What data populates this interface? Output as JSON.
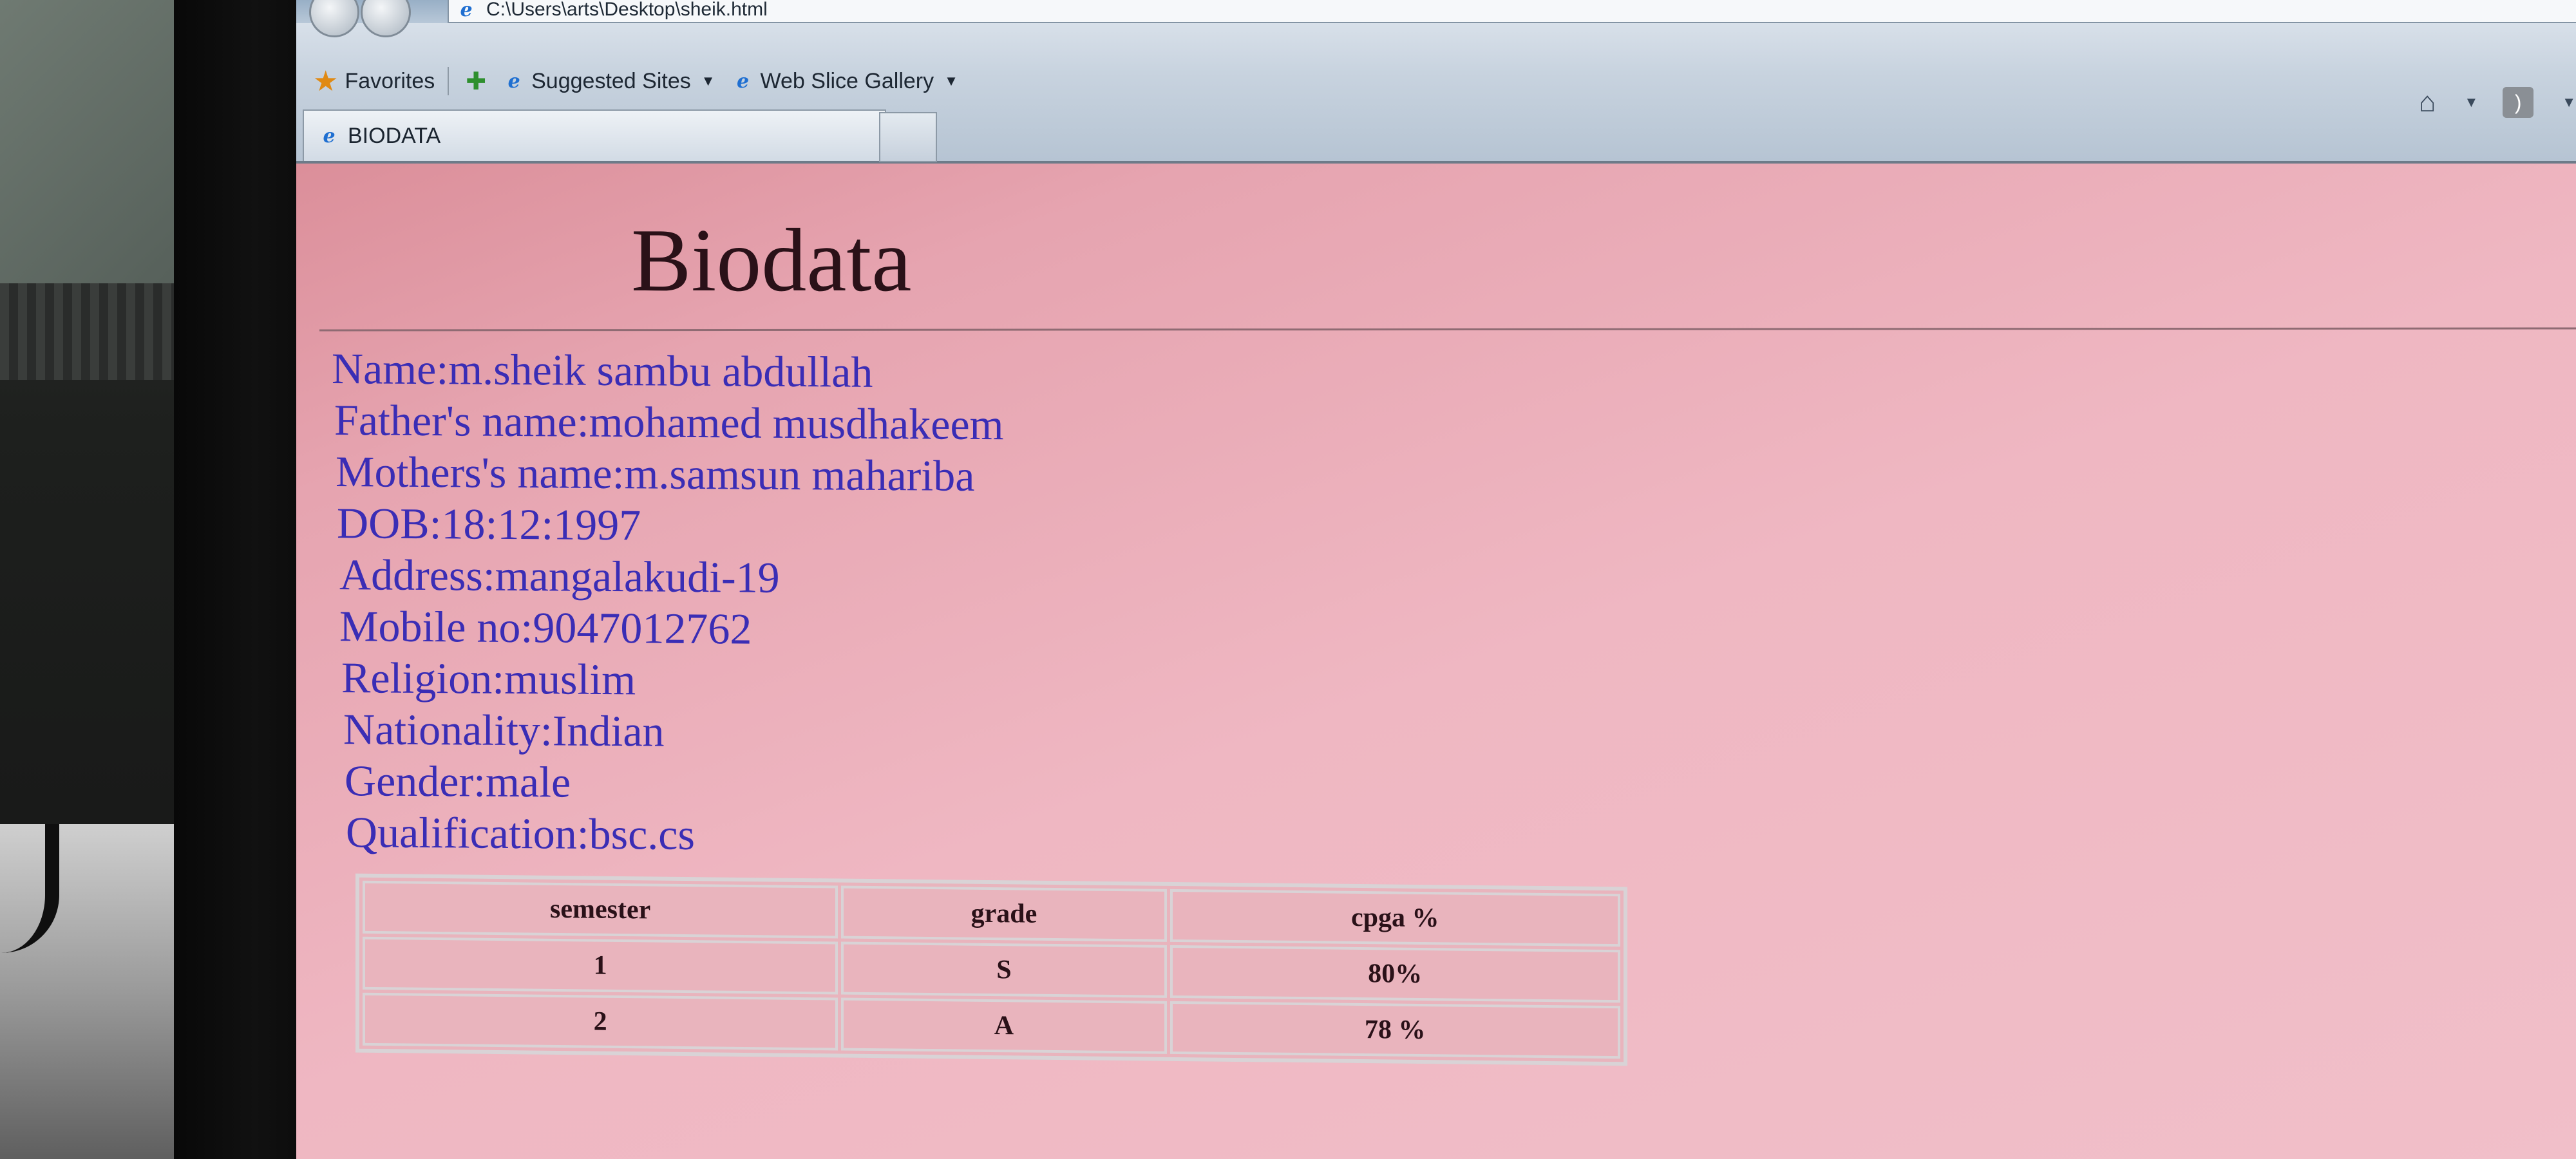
{
  "browser": {
    "address": "C:\\Users\\arts\\Desktop\\sheik.html",
    "favorites_label": "Favorites",
    "suggested_sites_label": "Suggested Sites",
    "web_slice_gallery_label": "Web Slice Gallery",
    "tab_title": "BIODATA"
  },
  "page": {
    "heading": "Biodata",
    "details": [
      "Name:m.sheik sambu abdullah",
      "Father's name:mohamed musdhakeem",
      "Mothers's name:m.samsun mahariba",
      "DOB:18:12:1997",
      "Address:mangalakudi-19",
      "Mobile no:9047012762",
      "Religion:muslim",
      "Nationality:Indian",
      "Gender:male",
      "Qualification:bsc.cs"
    ],
    "table": {
      "headers": [
        "semester",
        "grade",
        "cpga %"
      ],
      "rows": [
        [
          "1",
          "S",
          "80%"
        ],
        [
          "2",
          "A",
          "78 %"
        ]
      ]
    }
  },
  "colors": {
    "page_background": "#efb7c2",
    "detail_text": "#3a2db5",
    "heading_text": "#2a1118"
  }
}
